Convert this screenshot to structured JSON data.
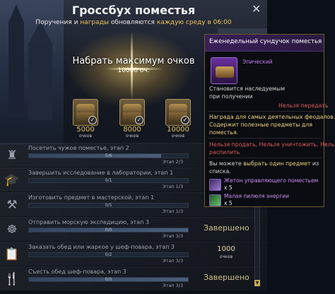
{
  "window": {
    "title": "Гроссбух поместья",
    "close_glyph": "✕",
    "subtitle_a": "Поручения и",
    "subtitle_b": "награды",
    "subtitle_c": "обновляются",
    "subtitle_d": "каждую среду в 06:00"
  },
  "goal": {
    "title": "Набрать максимум очков",
    "points": "10000 оч."
  },
  "milestones": [
    {
      "points": "5000",
      "label": "очков",
      "icon": "chest-icon",
      "claimed": true
    },
    {
      "points": "8000",
      "label": "очков",
      "icon": "chest-icon",
      "claimed": true
    },
    {
      "points": "10000",
      "label": "очков",
      "icon": "chest-icon",
      "claimed": true
    }
  ],
  "quests": [
    {
      "icon": "castle-icon",
      "glyph": "♜",
      "name": "Посетить чужое поместье, этап 2",
      "progress": "5/6",
      "fill": 0.83,
      "stage": "Этап 2/3",
      "status": "",
      "reward": ""
    },
    {
      "icon": "graduation-cap-icon",
      "glyph": "🎓",
      "name": "Завершить исследование в лаборатории, этап 1",
      "progress": "0/1",
      "fill": 0.0,
      "stage": "Этап 1/3",
      "status": "",
      "reward": ""
    },
    {
      "icon": "tools-icon",
      "glyph": "⚒",
      "name": "Изготовить предмет в мастерской, этап 1",
      "progress": "0/5",
      "fill": 0.0,
      "stage": "Этап 1/3",
      "status": "",
      "reward": ""
    },
    {
      "icon": "ship-wheel-icon",
      "glyph": "☸",
      "name": "Отправить морскую экспедицию, этап 3",
      "progress": "0/0",
      "fill": 1.0,
      "stage": "Этап 3/3",
      "status": "Завершено",
      "reward": ""
    },
    {
      "icon": "clipboard-icon",
      "glyph": "📋",
      "name": "Заказать обед или жаркое у шеф-повара, этап 3",
      "progress": "0/2",
      "fill": 0.0,
      "stage": "Этап 3/3",
      "status": "",
      "reward": "1000",
      "reward_label": "очков"
    },
    {
      "icon": "cutlery-icon",
      "glyph": "🍴",
      "name": "Съесть обед шеф-повара, этап 3",
      "progress": "0/0",
      "fill": 1.0,
      "stage": "Этап 3/3",
      "status": "Завершено",
      "reward": ""
    }
  ],
  "tooltip": {
    "title": "Еженедельный сундучок поместья",
    "rarity": "Эпический",
    "bind_1": "Становится наследуемым",
    "bind_2": "при получении",
    "no_transfer": "Нельзя передать",
    "desc_1": "Награда для самых деятельных феодалов.",
    "desc_2": "Содержит полезные предметы для",
    "desc_3": "поместья.",
    "restrict_1": "Нельзя продать",
    "restrict_2": "Нельзя уничтожить",
    "restrict_3": "Нельзя",
    "restrict_4": "распилить",
    "choose_a": "Вы можете",
    "choose_b": "выбрать один предмет",
    "choose_c": "из",
    "choose_d": "списка.",
    "items": [
      {
        "name": "Жетон управляющего поместьем",
        "qty": "x 5",
        "icon": "token-icon"
      },
      {
        "name": "Малая пилюля энергии",
        "qty": "x 5",
        "icon": "potion-icon"
      }
    ]
  },
  "colors": {
    "accent": "#e8c35a",
    "warning": "#e15b5b",
    "epic": "#c77df0",
    "tooltip_bg": "#0a0c11"
  }
}
